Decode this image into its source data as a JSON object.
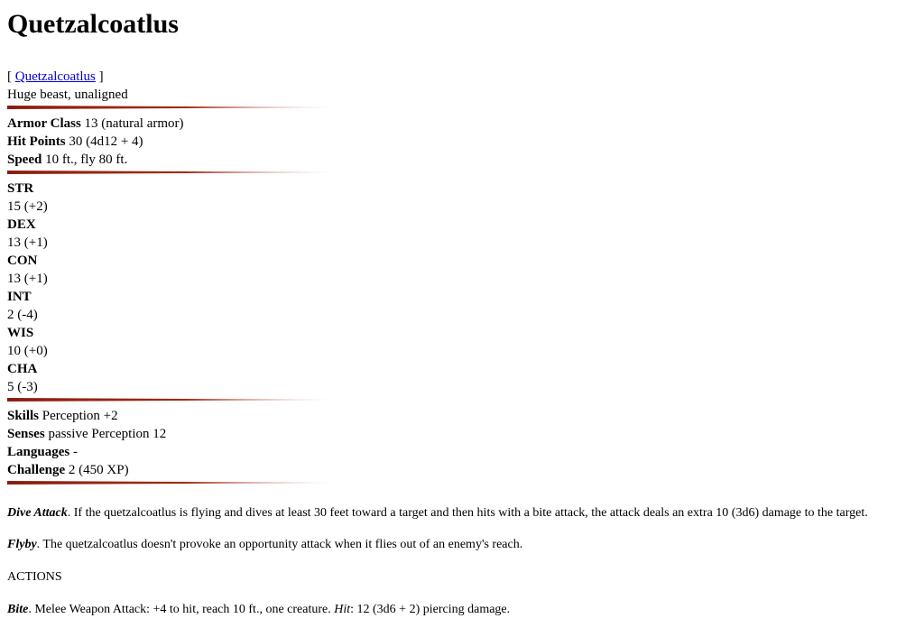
{
  "title": "Quetzalcoatlus",
  "source": {
    "open": "[ ",
    "link": "Quetzalcoatlus",
    "close": " ]"
  },
  "type_line": "Huge beast, unaligned",
  "defense": [
    {
      "label": "Armor Class",
      "value": " 13 (natural armor)"
    },
    {
      "label": "Hit Points",
      "value": " 30 (4d12 + 4)"
    },
    {
      "label": "Speed",
      "value": " 10 ft., fly 80 ft."
    }
  ],
  "abilities": [
    {
      "name": "STR",
      "score": "15 (+2)"
    },
    {
      "name": "DEX",
      "score": "13 (+1)"
    },
    {
      "name": "CON",
      "score": "13 (+1)"
    },
    {
      "name": "INT",
      "score": "2 (-4)"
    },
    {
      "name": "WIS",
      "score": "10 (+0)"
    },
    {
      "name": "CHA",
      "score": "5 (-3)"
    }
  ],
  "details": [
    {
      "label": "Skills",
      "value": " Perception +2"
    },
    {
      "label": "Senses",
      "value": " passive Perception 12"
    },
    {
      "label": "Languages",
      "value": " -"
    },
    {
      "label": "Challenge",
      "value": " 2 (450 XP)"
    }
  ],
  "traits": [
    {
      "name": "Dive Attack",
      "text": ". If the quetzalcoatlus is flying and dives at least 30 feet toward a target and then hits with a bite attack, the attack deals an extra 10 (3d6) damage to the target."
    },
    {
      "name": "Flyby",
      "text": ". The quetzalcoatlus doesn't provoke an opportunity attack when it flies out of an enemy's reach."
    }
  ],
  "actions_heading": "ACTIONS",
  "action": {
    "name": "Bite",
    "text1": ". Melee Weapon Attack: +4 to hit, reach 10 ft., one creature. ",
    "hit_label": "Hit",
    "text2": ": 12 (3d6 + 2) piercing damage."
  }
}
